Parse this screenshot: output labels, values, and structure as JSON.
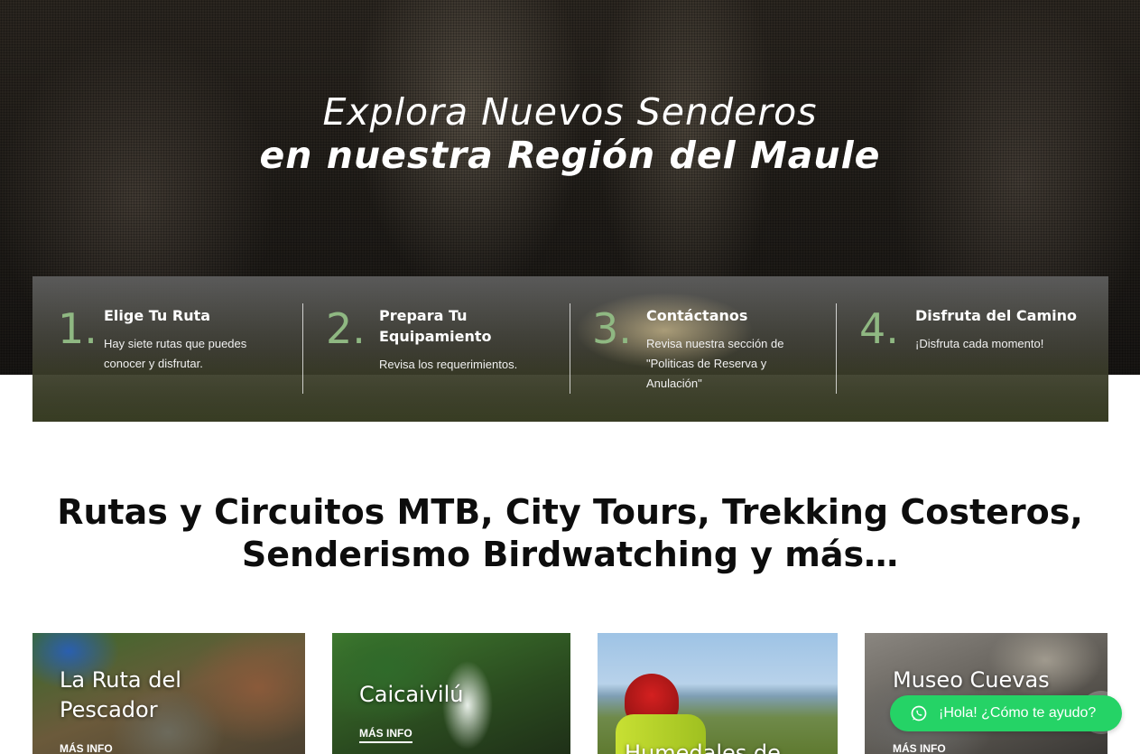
{
  "hero": {
    "line1": "Explora Nuevos Senderos",
    "line2": "en nuestra Región del Maule"
  },
  "steps": [
    {
      "number": "1.",
      "title": "Elige Tu Ruta",
      "description": "Hay siete rutas que puedes conocer y disfrutar."
    },
    {
      "number": "2.",
      "title": "Prepara Tu Equipamiento",
      "description": "Revisa los requerimientos."
    },
    {
      "number": "3.",
      "title": "Contáctanos",
      "description": "Revisa nuestra sección de \"Politicas de Reserva y Anulación\""
    },
    {
      "number": "4.",
      "title": "Disfruta del Camino",
      "description": "¡Disfruta cada momento!"
    }
  ],
  "section": {
    "heading_line1": "Rutas y Circuitos MTB, City Tours, Trekking Costeros,",
    "heading_line2": "Senderismo Birdwatching y más…"
  },
  "cards": [
    {
      "title": "La Ruta del Pescador",
      "link": "MÁS INFO"
    },
    {
      "title": "Caicaivilú",
      "link": "MÁS INFO"
    },
    {
      "title": "Humedales de",
      "link": ""
    },
    {
      "title": "Museo Cuevas",
      "link": "MÁS INFO"
    }
  ],
  "whatsapp": {
    "label": "¡Hola! ¿Cómo te ayudo?",
    "icon": "whatsapp-icon",
    "color": "#25d366"
  },
  "colors": {
    "step_number": "#8fb882"
  }
}
